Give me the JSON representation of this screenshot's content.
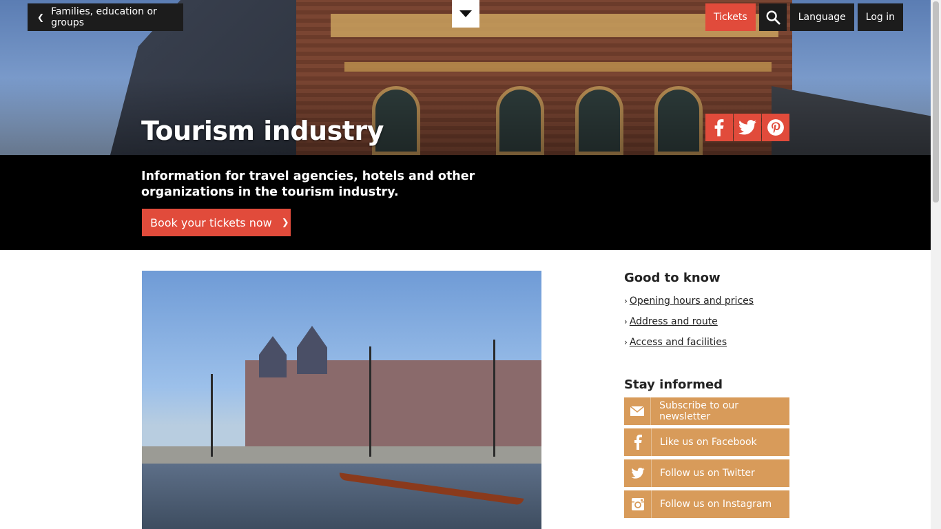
{
  "header": {
    "back_label": "Families, education or groups",
    "nav": {
      "tickets": "Tickets",
      "language": "Language",
      "login": "Log in"
    },
    "page_title": "Tourism industry"
  },
  "band": {
    "intro": "Information for travel agencies, hotels and other organizations in the tourism industry.",
    "cta_label": "Book your tickets now"
  },
  "aside": {
    "good_to_know_title": "Good to know",
    "links": [
      {
        "label": "Opening hours and prices"
      },
      {
        "label": "Address and route"
      },
      {
        "label": "Access and facilities"
      }
    ],
    "stay_informed_title": "Stay informed",
    "social": [
      {
        "label": "Subscribe to our newsletter",
        "icon": "mail-icon"
      },
      {
        "label": "Like us on Facebook",
        "icon": "facebook-icon"
      },
      {
        "label": "Follow us on Twitter",
        "icon": "twitter-icon"
      },
      {
        "label": "Follow us on Instagram",
        "icon": "instagram-icon"
      }
    ]
  },
  "colors": {
    "accent_red": "#e14b3b",
    "social_orange": "#d89b5a",
    "band_black": "#000000"
  }
}
